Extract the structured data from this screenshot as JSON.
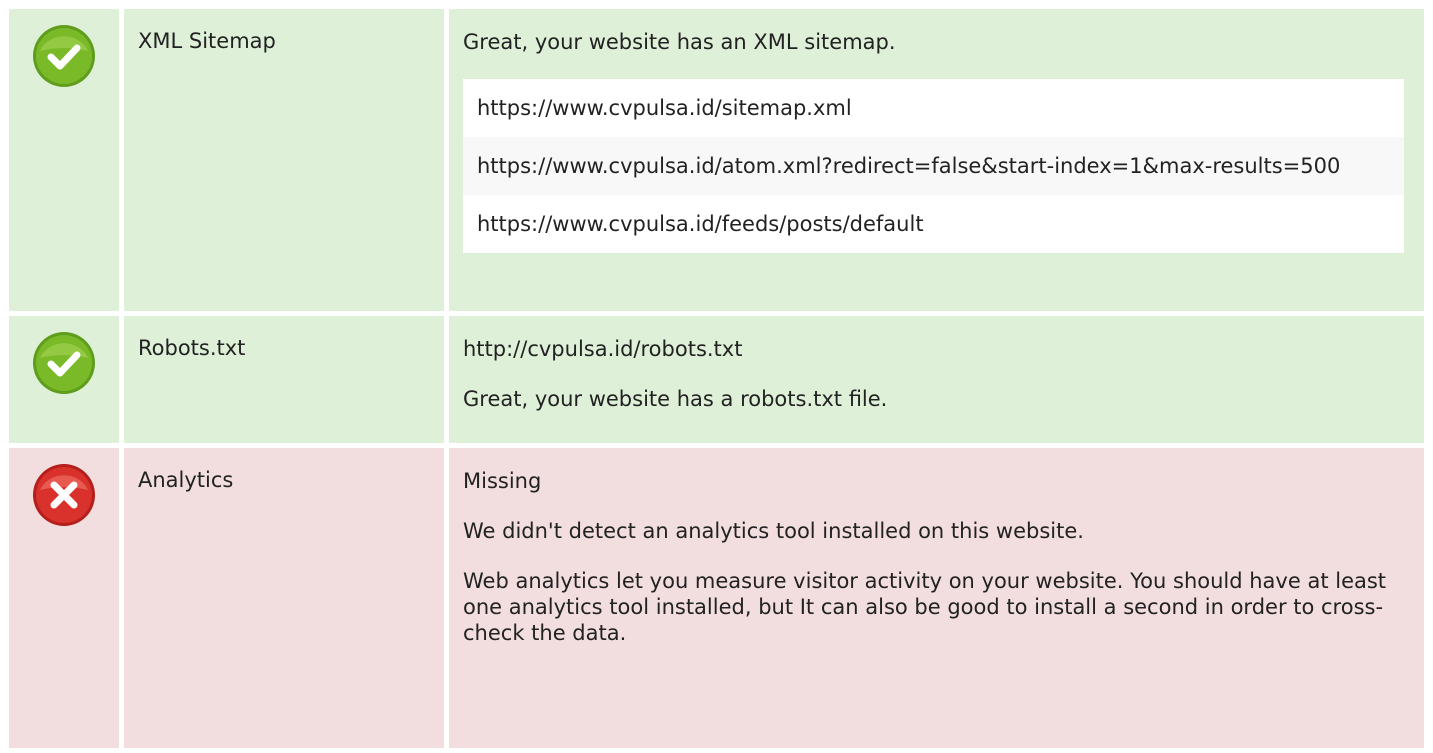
{
  "rows": [
    {
      "status": "pass",
      "icon": "check-circle-icon",
      "label": "XML Sitemap",
      "message": "Great, your website has an XML sitemap.",
      "urls": [
        "https://www.cvpulsa.id/sitemap.xml",
        "https://www.cvpulsa.id/atom.xml?redirect=false&start-index=1&max-results=500",
        "https://www.cvpulsa.id/feeds/posts/default"
      ]
    },
    {
      "status": "pass",
      "icon": "check-circle-icon",
      "label": "Robots.txt",
      "lines": [
        "http://cvpulsa.id/robots.txt",
        "Great, your website has a robots.txt file."
      ]
    },
    {
      "status": "fail",
      "icon": "x-circle-icon",
      "label": "Analytics",
      "lines": [
        "Missing",
        "We didn't detect an analytics tool installed on this website.",
        "Web analytics let you measure visitor activity on your website. You should have at least one analytics tool installed, but It can also be good to install a second in order to cross-check the data."
      ]
    }
  ],
  "colors": {
    "pass_bg": "#dff0d8",
    "fail_bg": "#f2dedf",
    "pass_icon": "#7ab928",
    "fail_icon": "#d9322c"
  }
}
